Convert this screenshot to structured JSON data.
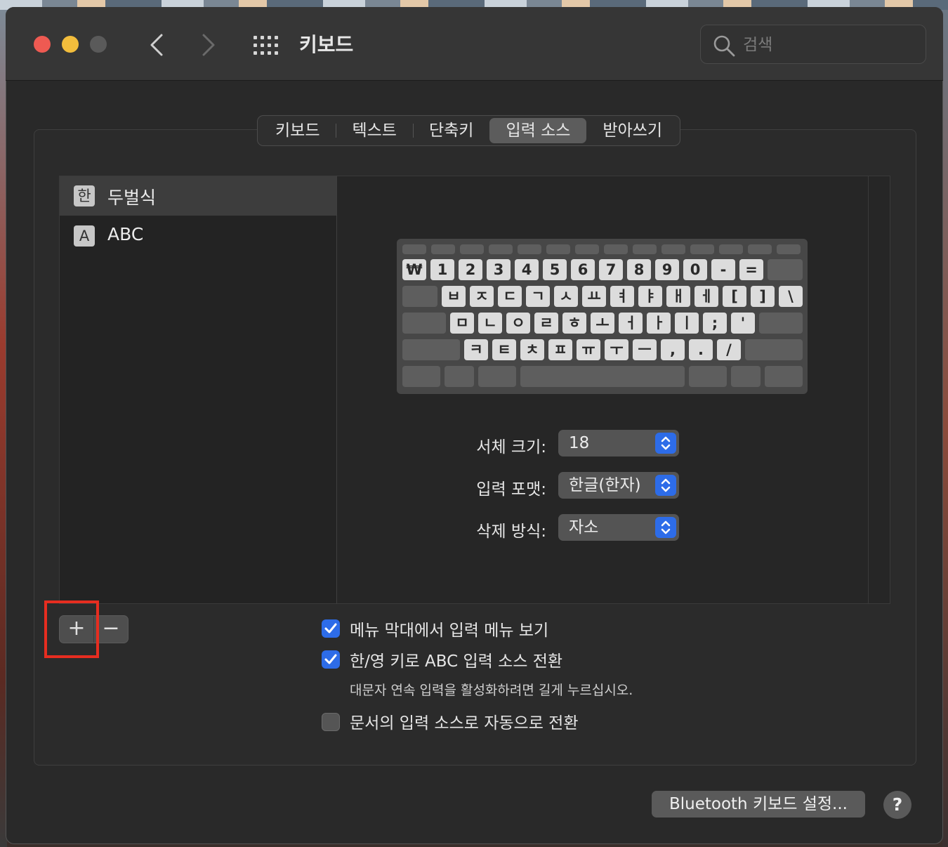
{
  "window": {
    "title": "키보드",
    "search_placeholder": "검색"
  },
  "tabs": [
    {
      "label": "키보드",
      "active": false
    },
    {
      "label": "텍스트",
      "active": false
    },
    {
      "label": "단축키",
      "active": false
    },
    {
      "label": "입력 소스",
      "active": true
    },
    {
      "label": "받아쓰기",
      "active": false
    }
  ],
  "sources": [
    {
      "badge": "한",
      "label": "두벌식",
      "selected": true
    },
    {
      "badge": "A",
      "label": "ABC",
      "selected": false
    }
  ],
  "keyboard": {
    "row1": [
      "₩",
      "1",
      "2",
      "3",
      "4",
      "5",
      "6",
      "7",
      "8",
      "9",
      "0",
      "-",
      "="
    ],
    "row2": [
      "ㅂ",
      "ㅈ",
      "ㄷ",
      "ㄱ",
      "ㅅ",
      "ㅛ",
      "ㅕ",
      "ㅑ",
      "ㅐ",
      "ㅔ",
      "[",
      "]",
      "\\"
    ],
    "row3": [
      "ㅁ",
      "ㄴ",
      "ㅇ",
      "ㄹ",
      "ㅎ",
      "ㅗ",
      "ㅓ",
      "ㅏ",
      "ㅣ",
      ";",
      "'"
    ],
    "row4": [
      "ㅋ",
      "ㅌ",
      "ㅊ",
      "ㅍ",
      "ㅠ",
      "ㅜ",
      "ㅡ",
      ",",
      ".",
      "/"
    ]
  },
  "settings": {
    "font_size_label": "서체 크기:",
    "font_size_value": "18",
    "input_format_label": "입력 포맷:",
    "input_format_value": "한글(한자)",
    "delete_mode_label": "삭제 방식:",
    "delete_mode_value": "자소"
  },
  "list_controls": {
    "add": "+",
    "remove": "−"
  },
  "checkboxes": [
    {
      "label": "메뉴 막대에서 입력 메뉴 보기",
      "checked": true
    },
    {
      "label": "한/영 키로 ABC 입력 소스 전환",
      "checked": true,
      "hint": "대문자 연속 입력을 활성화하려면 길게 누르십시오."
    },
    {
      "label": "문서의 입력 소스로 자동으로 전환",
      "checked": false
    }
  ],
  "footer": {
    "bluetooth_button": "Bluetooth 키보드 설정...",
    "help_button": "?"
  },
  "colors": {
    "accent": "#2d6ce8",
    "highlight": "#e62d20",
    "close": "#ee5a52",
    "minimize": "#f2bd3c"
  }
}
